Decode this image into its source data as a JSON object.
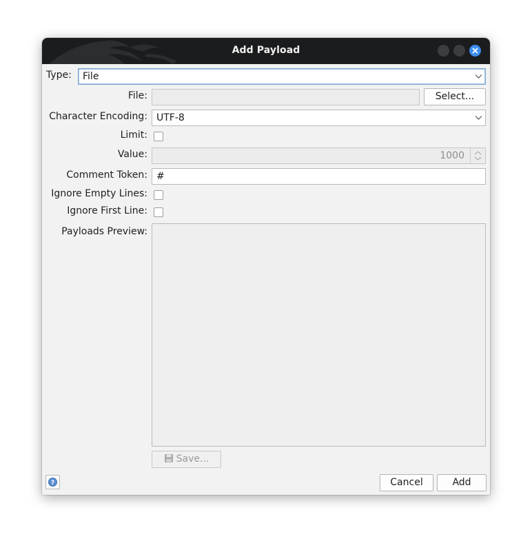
{
  "window": {
    "title": "Add Payload"
  },
  "form": {
    "type": {
      "label": "Type:",
      "value": "File"
    },
    "file": {
      "label": "File:",
      "value": "",
      "select_button": "Select..."
    },
    "encoding": {
      "label": "Character Encoding:",
      "value": "UTF-8"
    },
    "limit": {
      "label": "Limit:",
      "checked": false
    },
    "value": {
      "label": "Value:",
      "value": "1000"
    },
    "comment_token": {
      "label": "Comment Token:",
      "value": "#"
    },
    "ignore_empty": {
      "label": "Ignore Empty Lines:",
      "checked": false
    },
    "ignore_first": {
      "label": "Ignore First Line:",
      "checked": false
    },
    "preview": {
      "label": "Payloads Preview:",
      "save_button": "Save..."
    }
  },
  "footer": {
    "cancel": "Cancel",
    "add": "Add"
  },
  "icons": [
    "dragon-logo-icon",
    "minimize-icon",
    "maximize-icon",
    "close-icon",
    "chevron-down-icon",
    "spinner-icon",
    "floppy-disk-icon",
    "help-icon"
  ],
  "colors": {
    "titlebar": "#1b1c1e",
    "close_button": "#3c8ef0",
    "focus_border": "#7ea6d2"
  }
}
